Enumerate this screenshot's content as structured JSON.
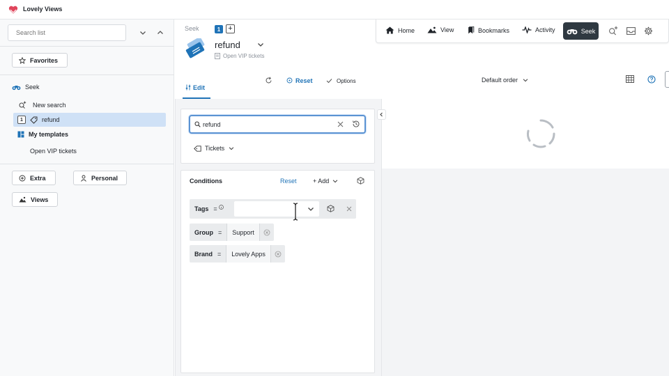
{
  "app": {
    "title": "Lovely Views"
  },
  "sidebar": {
    "search_placeholder": "Search list",
    "favorites_label": "Favorites",
    "seek_label": "Seek",
    "new_search_label": "New search",
    "selected_item": {
      "number": "1",
      "label": "refund"
    },
    "templates_label": "My templates",
    "template_item": "Open VIP tickets",
    "extra_label": "Extra",
    "personal_label": "Personal",
    "views_label": "Views"
  },
  "view": {
    "breadcrumb": "Seek",
    "tab_number": "1",
    "plus": "+",
    "title": "refund",
    "subtitle": "Open VIP tickets",
    "edit_tab": "Edit",
    "reset_label": "Reset",
    "options_label": "Options",
    "search_value": "refund",
    "filter_label": "Tickets"
  },
  "conditions": {
    "title": "Conditions",
    "reset_label": "Reset",
    "add_label": "+ Add",
    "rows": [
      {
        "key": "Tags",
        "op": "=",
        "value": ""
      },
      {
        "key": "Group",
        "op": "=",
        "value": "Support"
      },
      {
        "key": "Brand",
        "op": "=",
        "value": "Lovely Apps"
      }
    ]
  },
  "results": {
    "order_label": "Default order"
  },
  "nav": {
    "home": "Home",
    "view": "View",
    "bookmarks": "Bookmarks",
    "activity": "Activity",
    "seek": "Seek"
  },
  "colors": {
    "accent": "#1f73b7",
    "nav_active_bg": "#2f3941",
    "selected_bg": "#cfe1f6",
    "logo": "#e0455c"
  }
}
